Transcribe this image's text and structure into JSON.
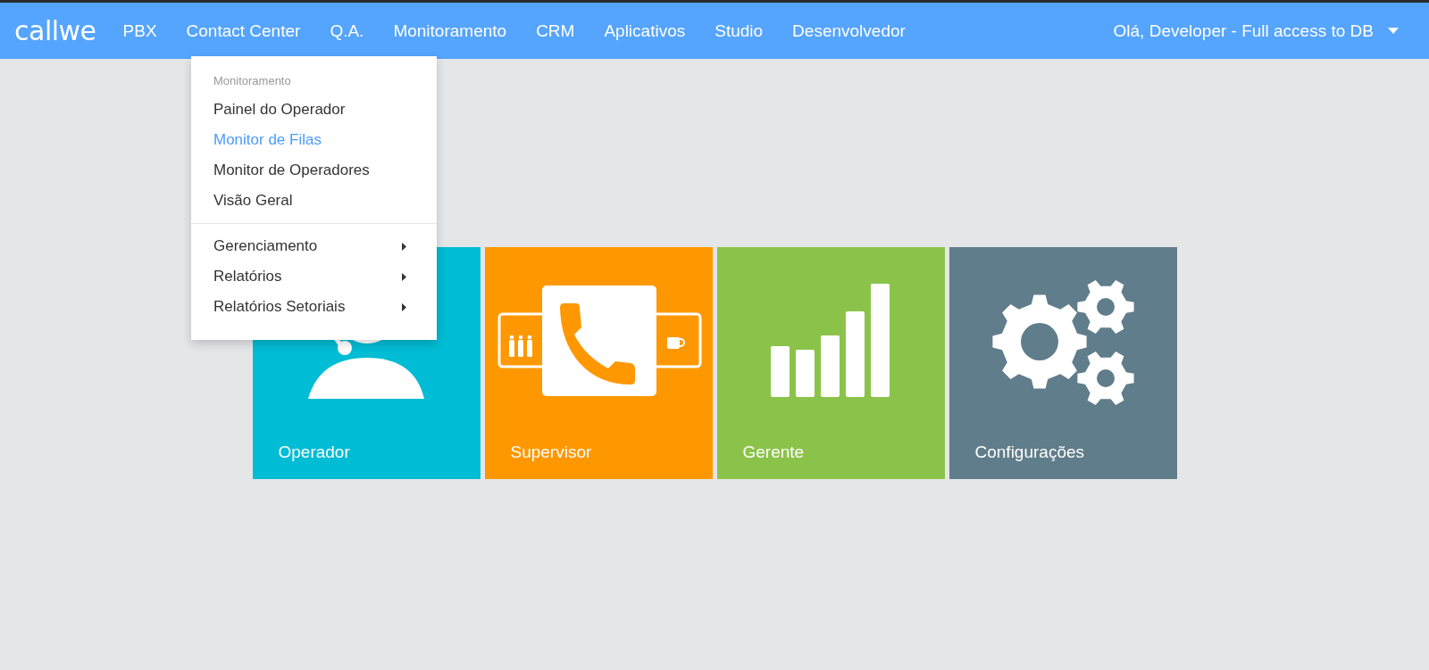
{
  "navbar": {
    "logo": "callwe",
    "items": [
      {
        "label": "PBX"
      },
      {
        "label": "Contact Center"
      },
      {
        "label": "Q.A."
      },
      {
        "label": "Monitoramento"
      },
      {
        "label": "CRM"
      },
      {
        "label": "Aplicativos"
      },
      {
        "label": "Studio"
      },
      {
        "label": "Desenvolvedor"
      }
    ],
    "user_menu": {
      "label": "Olá, Developer - Full access to DB"
    }
  },
  "dropdown": {
    "groups": [
      {
        "header": "Monitoramento",
        "items": [
          {
            "label": "Painel do Operador",
            "kind": "link",
            "selected": false
          },
          {
            "label": "Monitor de Filas",
            "kind": "link",
            "selected": true
          },
          {
            "label": "Monitor de Operadores",
            "kind": "link",
            "selected": false
          },
          {
            "label": "Visão Geral",
            "kind": "link",
            "selected": false
          }
        ]
      },
      {
        "items": [
          {
            "label": "Gerenciamento",
            "kind": "submenu",
            "selected": false
          },
          {
            "label": "Relatórios",
            "kind": "submenu",
            "selected": false
          },
          {
            "label": "Relatórios Setoriais",
            "kind": "submenu",
            "selected": false
          }
        ]
      }
    ]
  },
  "tiles": [
    {
      "label": "Operador",
      "kind": "operator",
      "color": "#00bcd4"
    },
    {
      "label": "Supervisor",
      "kind": "supervisor",
      "color": "#ff9800"
    },
    {
      "label": "Gerente",
      "kind": "manager",
      "color": "#8bc34a"
    },
    {
      "label": "Configurações",
      "kind": "settings",
      "color": "#607d8b"
    }
  ]
}
